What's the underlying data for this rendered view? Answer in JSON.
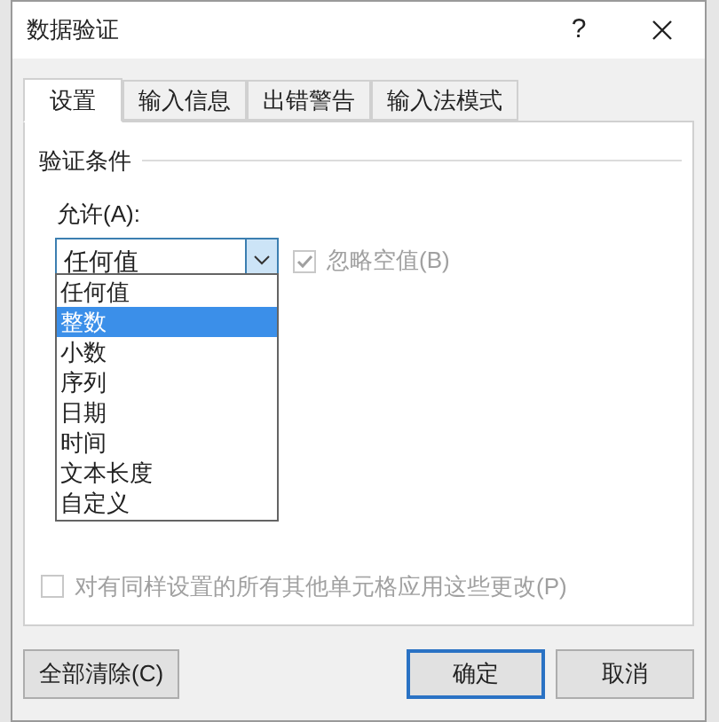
{
  "window": {
    "title": "数据验证",
    "help": "?"
  },
  "tabs": [
    {
      "label": "设置",
      "selected": true
    },
    {
      "label": "输入信息",
      "selected": false
    },
    {
      "label": "出错警告",
      "selected": false
    },
    {
      "label": "输入法模式",
      "selected": false
    }
  ],
  "group_title": "验证条件",
  "allow": {
    "label": "允许(A):",
    "value": "任何值",
    "expanded": true,
    "options": [
      {
        "label": "任何值",
        "highlighted": false
      },
      {
        "label": "整数",
        "highlighted": true
      },
      {
        "label": "小数",
        "highlighted": false
      },
      {
        "label": "序列",
        "highlighted": false
      },
      {
        "label": "日期",
        "highlighted": false
      },
      {
        "label": "时间",
        "highlighted": false
      },
      {
        "label": "文本长度",
        "highlighted": false
      },
      {
        "label": "自定义",
        "highlighted": false
      }
    ]
  },
  "ignore_blank": {
    "label": "忽略空值(B)",
    "checked": true,
    "disabled": true
  },
  "apply_all": {
    "label": "对有同样设置的所有其他单元格应用这些更改(P)",
    "checked": false,
    "disabled": true
  },
  "buttons": [
    {
      "label": "全部清除(C)",
      "default": false
    },
    {
      "label": "确定",
      "default": true
    },
    {
      "label": "取消",
      "default": false
    }
  ]
}
